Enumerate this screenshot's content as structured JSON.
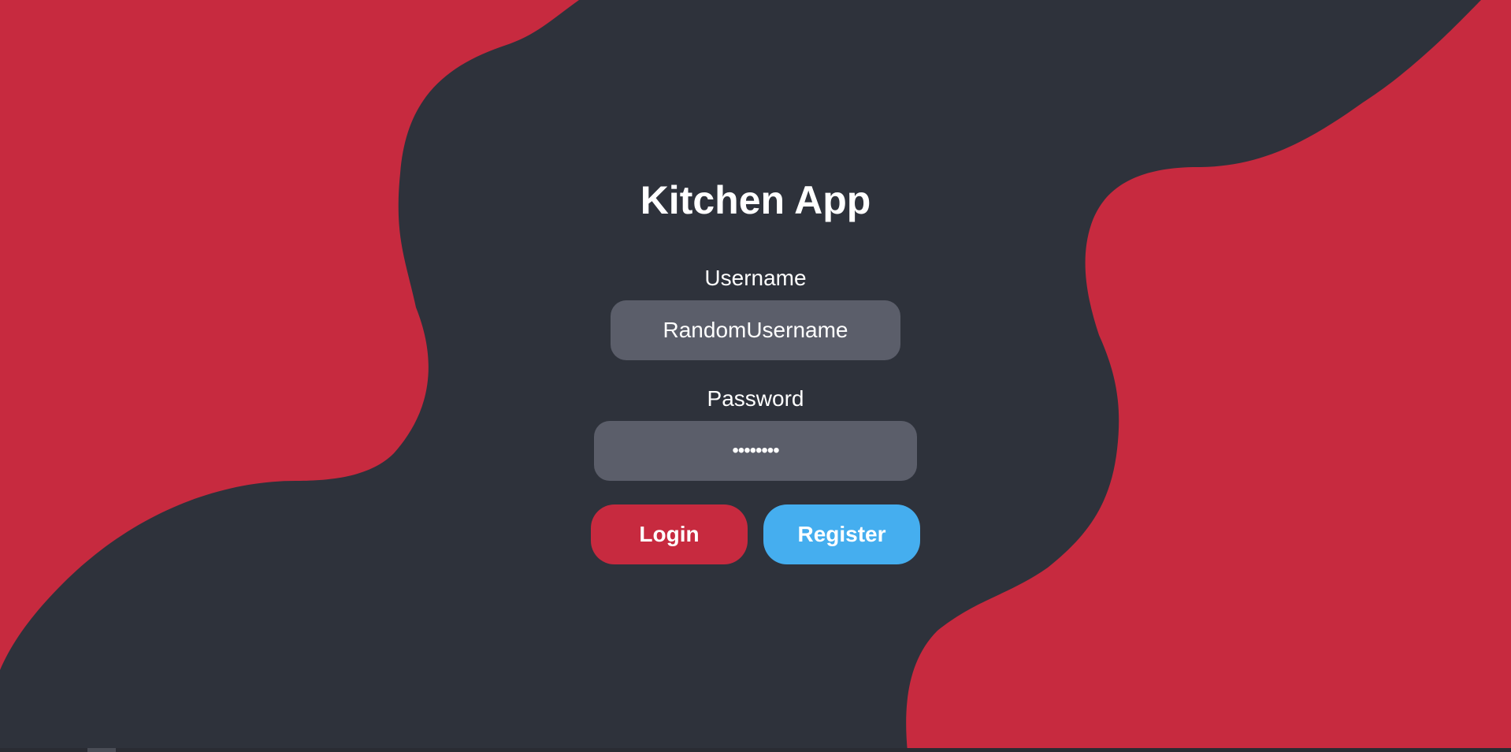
{
  "app": {
    "title": "Kitchen App"
  },
  "form": {
    "username": {
      "label": "Username",
      "value": "RandomUsername"
    },
    "password": {
      "label": "Password",
      "value": "••••••••"
    }
  },
  "actions": {
    "login_label": "Login",
    "register_label": "Register"
  },
  "colors": {
    "background": "#2e323b",
    "accent_red": "#c72a3f",
    "accent_blue": "#45aeef",
    "field_bg": "#5b5e6a",
    "text": "#ffffff"
  }
}
